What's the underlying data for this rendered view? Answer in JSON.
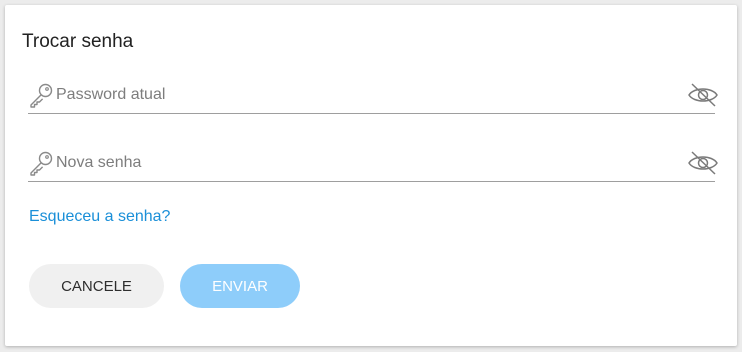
{
  "dialog": {
    "title": "Trocar senha",
    "fields": [
      {
        "placeholder": "Password atual",
        "value": "",
        "icon": "key-icon",
        "toggle_icon": "eye-off-icon"
      },
      {
        "placeholder": "Nova senha",
        "value": "",
        "icon": "key-icon",
        "toggle_icon": "eye-off-icon"
      }
    ],
    "forgot_link": "Esqueceu a senha?",
    "buttons": {
      "cancel_label": "CANCELE",
      "send_label": "ENVIAR"
    }
  },
  "colors": {
    "link": "#1a8fd8",
    "send_button_disabled": "#8ecdfa",
    "cancel_button": "#f0f0f0",
    "field_underline": "#9e9e9e"
  }
}
